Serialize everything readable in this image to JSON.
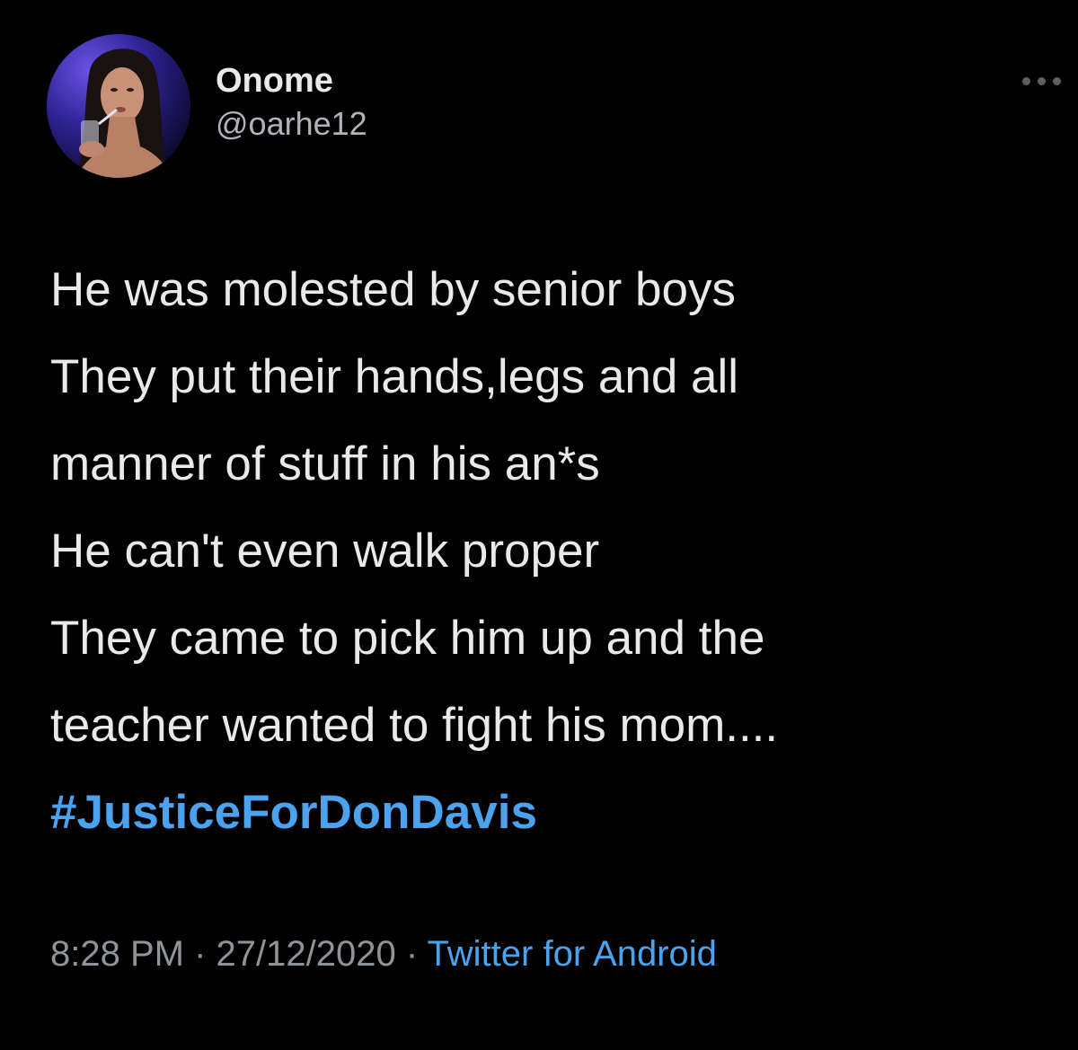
{
  "user": {
    "display_name": "Onome",
    "handle": "@oarhe12"
  },
  "more_icon": "more-horizontal-icon",
  "tweet": {
    "lines": [
      "He was molested by senior boys",
      "They put their hands,legs and all",
      "manner of stuff in his an*s",
      "He can't even walk proper",
      "They came to pick him up and the",
      "teacher wanted to fight his mom...."
    ],
    "hashtag": "#JusticeForDonDavis"
  },
  "meta": {
    "time": "8:28 PM",
    "separator": " · ",
    "date": "27/12/2020",
    "source": "Twitter for Android"
  },
  "colors": {
    "background": "#000000",
    "text": "#e7e9ea",
    "link": "#4ba3f0",
    "muted": "#8f949a"
  }
}
